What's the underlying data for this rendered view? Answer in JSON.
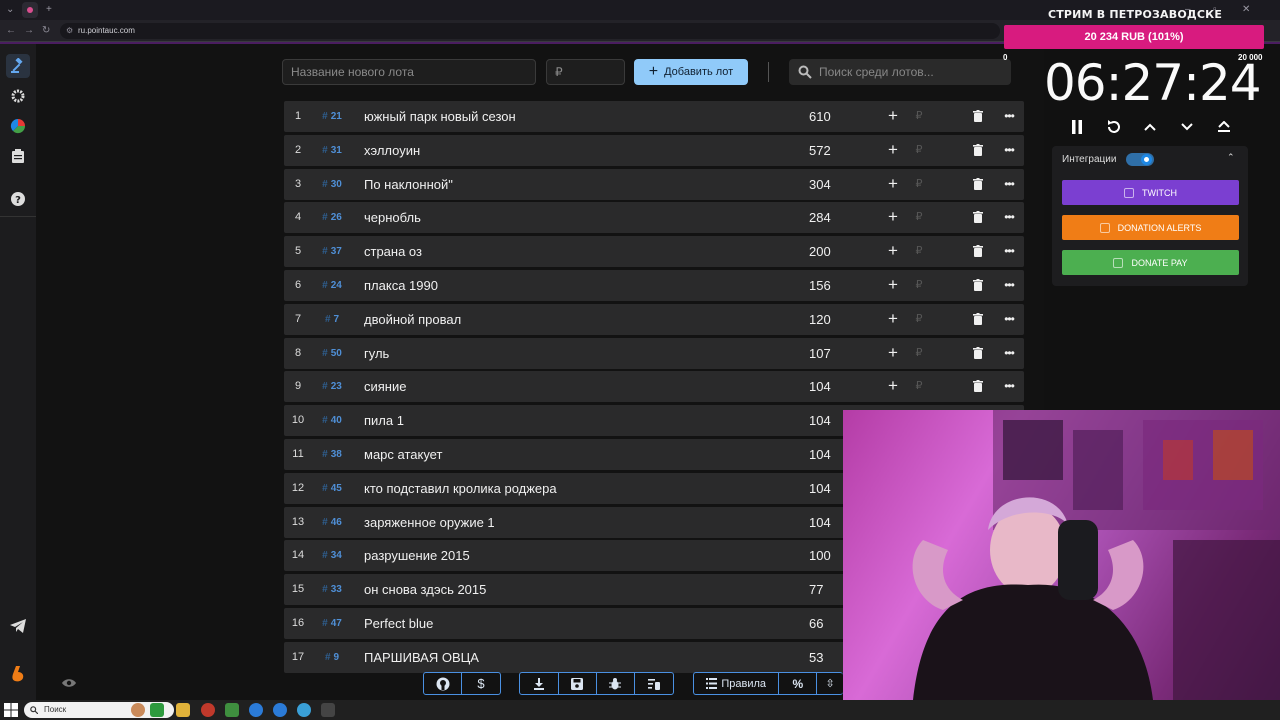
{
  "browser": {
    "url": "ru.pointauc.com"
  },
  "toolbar": {
    "new_lot_placeholder": "Название нового лота",
    "amount_placeholder": "₽",
    "add_lot_label": "Добавить лот",
    "search_placeholder": "Поиск среди лотов..."
  },
  "lots": [
    {
      "rank": "1",
      "id": "21",
      "name": "южный парк новый сезон",
      "amount": "610"
    },
    {
      "rank": "2",
      "id": "31",
      "name": "хэллоуин",
      "amount": "572"
    },
    {
      "rank": "3",
      "id": "30",
      "name": "По наклонной\"",
      "amount": "304"
    },
    {
      "rank": "4",
      "id": "26",
      "name": "чернобль",
      "amount": "284"
    },
    {
      "rank": "5",
      "id": "37",
      "name": "страна оз",
      "amount": "200"
    },
    {
      "rank": "6",
      "id": "24",
      "name": "плакса 1990",
      "amount": "156"
    },
    {
      "rank": "7",
      "id": "7",
      "name": " двойной провал",
      "amount": "120"
    },
    {
      "rank": "8",
      "id": "50",
      "name": "гуль",
      "amount": "107"
    },
    {
      "rank": "9",
      "id": "23",
      "name": "сияние",
      "amount": "104"
    },
    {
      "rank": "10",
      "id": "40",
      "name": "пила 1",
      "amount": "104"
    },
    {
      "rank": "11",
      "id": "38",
      "name": "марс атакует",
      "amount": "104"
    },
    {
      "rank": "12",
      "id": "45",
      "name": "кто подставил кролика роджера",
      "amount": "104"
    },
    {
      "rank": "13",
      "id": "46",
      "name": "заряженное оружие 1",
      "amount": "104"
    },
    {
      "rank": "14",
      "id": "34",
      "name": "разрушение 2015",
      "amount": "100"
    },
    {
      "rank": "15",
      "id": "33",
      "name": "он снова здэсь 2015",
      "amount": "77"
    },
    {
      "rank": "16",
      "id": "47",
      "name": "Perfect blue",
      "amount": "66"
    },
    {
      "rank": "17",
      "id": "9",
      "name": "ПАРШИВАЯ ОВЦА",
      "amount": "53"
    }
  ],
  "row_rub_symbol": "₽",
  "id_hash": "#",
  "bottom_bar": {
    "rules_label": "Правила",
    "percent_label": "%"
  },
  "goal_overlay": {
    "title": "СТРИМ В ПЕТРОЗАВОДСКЕ",
    "progress_label": "20 234 RUB (101%)",
    "progress_fraction": 1.0,
    "min_label": "0",
    "max_label": "20 000",
    "accent_color": "#d81b7f"
  },
  "timer": {
    "value": "06:27:24"
  },
  "integrations": {
    "label": "Интеграции",
    "enabled": true,
    "buttons": [
      {
        "label": "TWITCH",
        "color": "#7b3fd1",
        "icon": "twitch-icon"
      },
      {
        "label": "DONATION ALERTS",
        "color": "#f07d16",
        "icon": "donation-alerts-icon"
      },
      {
        "label": "DONATE PAY",
        "color": "#4caf50",
        "icon": "donatepay-icon"
      }
    ]
  },
  "taskbar": {
    "search_label": "Поиск"
  },
  "colors": {
    "accent_blue": "#90caf9",
    "id_blue": "#4f8fd6",
    "row_bg": "#2a2a2b"
  }
}
